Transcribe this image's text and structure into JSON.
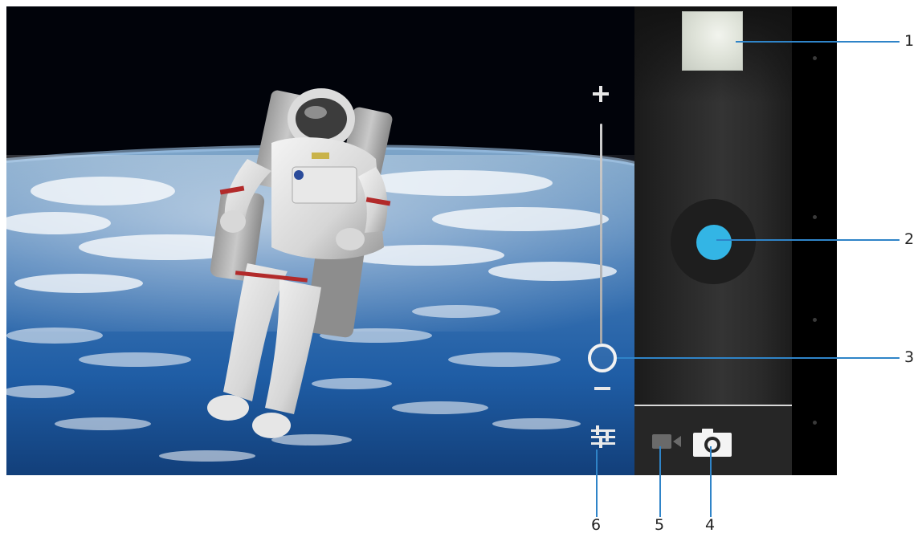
{
  "screen": {
    "zoom": {
      "plus": "+",
      "minus": "−",
      "level": 0.0
    },
    "modes": [
      "video",
      "photo"
    ],
    "active_mode": "photo"
  },
  "icons": {
    "settings": "settings-sliders-icon",
    "video": "video-camera-icon",
    "photo": "camera-icon",
    "shutter": "shutter-button"
  },
  "colors": {
    "shutter": "#33b5e5",
    "callout": "#2f84c8"
  },
  "callouts": [
    {
      "number": "1",
      "target": "thumbnail"
    },
    {
      "number": "2",
      "target": "shutter-button"
    },
    {
      "number": "3",
      "target": "zoom-slider"
    },
    {
      "number": "4",
      "target": "photo-mode"
    },
    {
      "number": "5",
      "target": "video-mode"
    },
    {
      "number": "6",
      "target": "settings"
    }
  ]
}
